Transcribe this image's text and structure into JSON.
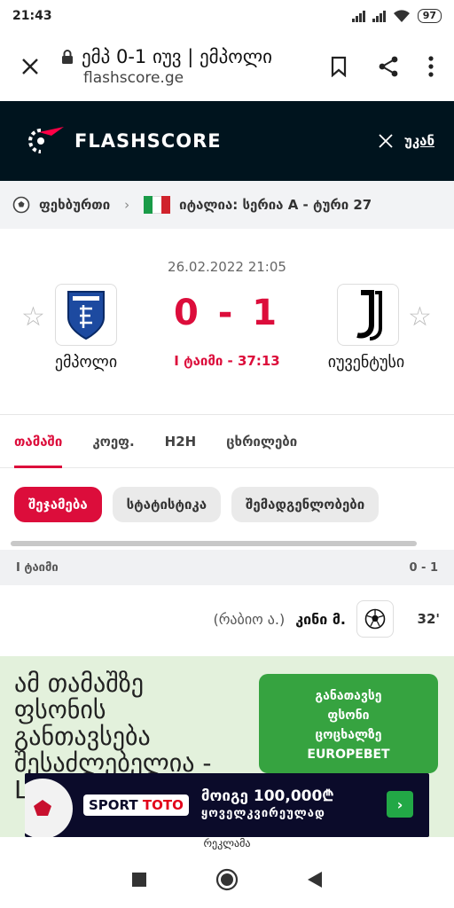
{
  "status": {
    "time": "21:43",
    "battery": "97"
  },
  "browser": {
    "page_title": "ემპ 0-1 იუვ | ემპოლი",
    "domain": "flashscore.ge"
  },
  "site": {
    "brand": "FLASHSCORE",
    "back_label": "უკან"
  },
  "breadcrumb": {
    "sport": "ფეხბურთი",
    "league": "იტალია: სერია A - ტური 27"
  },
  "match": {
    "date": "26.02.2022 21:05",
    "home": "ემპოლი",
    "away": "იუვენტუსი",
    "score": "0 - 1",
    "status": "I ტაიმი - 37:13"
  },
  "tabs": [
    "თამაში",
    "კოეფ.",
    "H2H",
    "ცხრილები"
  ],
  "subtabs": [
    "შეჯამება",
    "სტატისტიკა",
    "შემადგენლობები"
  ],
  "period": {
    "label": "I ტაიმი",
    "score": "0 - 1"
  },
  "event": {
    "assist": "(რაბიო ა.)",
    "player": "კინი მ.",
    "minute": "32'"
  },
  "ad": {
    "text": "ამ თამაშზე ფსონის განთავსება შესაძლებელია - Live",
    "cta_lines": [
      "განათავსე",
      "ფსონი",
      "ცოცხალზე",
      "EUROPEBET"
    ],
    "banner_brand": "SPORT",
    "banner_brand_accent": "TOTO",
    "banner_line1": "მოიგე 100,000₾",
    "banner_line2": "ყოველკვირეულად",
    "label": "რეკლამა"
  },
  "colors": {
    "accent": "#dc0d3b",
    "header_bg": "#00141e",
    "ad_bg": "#e3f1dc",
    "cta": "#36a340"
  }
}
